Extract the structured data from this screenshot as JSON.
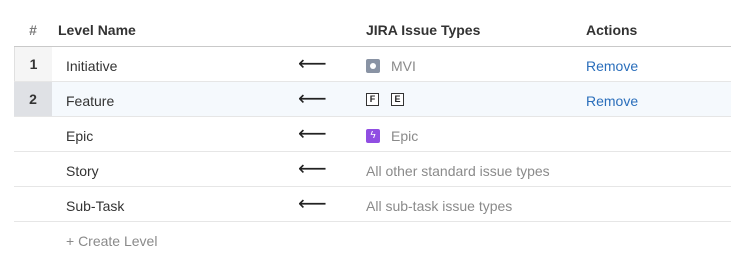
{
  "table": {
    "headers": {
      "num": "#",
      "level_name": "Level Name",
      "issue_types": "JIRA Issue Types",
      "actions": "Actions"
    },
    "arrow": "⟵",
    "rows": [
      {
        "num": "1",
        "name": "Initiative",
        "types_text": "MVI",
        "icon": "mvi-icon",
        "action": "Remove"
      },
      {
        "num": "2",
        "name": "Feature",
        "letters": [
          "F",
          "E"
        ],
        "action": "Remove"
      },
      {
        "name": "Epic",
        "types_text": "Epic",
        "icon": "epic-icon"
      },
      {
        "name": "Story",
        "types_text": "All other standard issue types"
      },
      {
        "name": "Sub-Task",
        "types_text": "All sub-task issue types"
      }
    ],
    "create_label": "+ Create Level"
  },
  "colors": {
    "link": "#2a6ebb",
    "epic": "#904ee2",
    "mvi": "#8993a4"
  }
}
